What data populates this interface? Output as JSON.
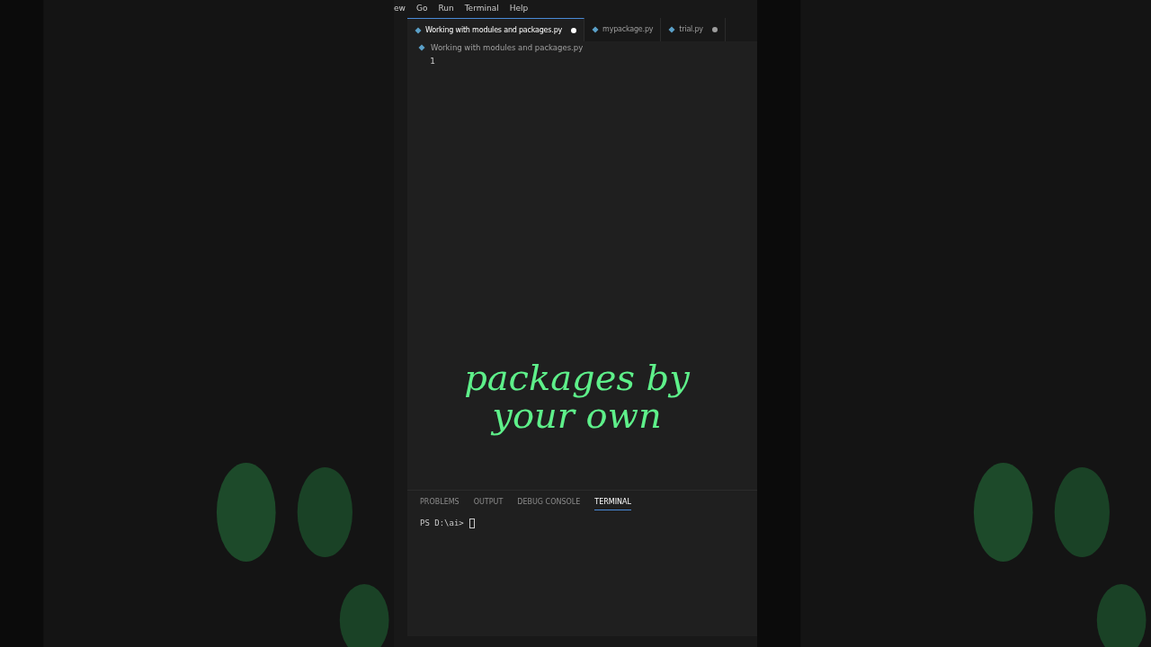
{
  "menu": [
    "ew",
    "Go",
    "Run",
    "Terminal",
    "Help"
  ],
  "tabs": [
    {
      "label": "Working with modules and packages.py",
      "selected": true,
      "modified": true
    },
    {
      "label": "mypackage.py",
      "selected": false,
      "modified": false
    },
    {
      "label": "trial.py",
      "selected": false,
      "modified": true
    }
  ],
  "breadcrumb": "Working with modules and packages.py",
  "line_numbers": [
    "1"
  ],
  "caption": [
    "packages by",
    "your own"
  ],
  "panel_tabs": [
    {
      "label": "PROBLEMS",
      "selected": false
    },
    {
      "label": "OUTPUT",
      "selected": false
    },
    {
      "label": "DEBUG CONSOLE",
      "selected": false
    },
    {
      "label": "TERMINAL",
      "selected": true
    }
  ],
  "terminal_prompt": "PS D:\\ai>"
}
